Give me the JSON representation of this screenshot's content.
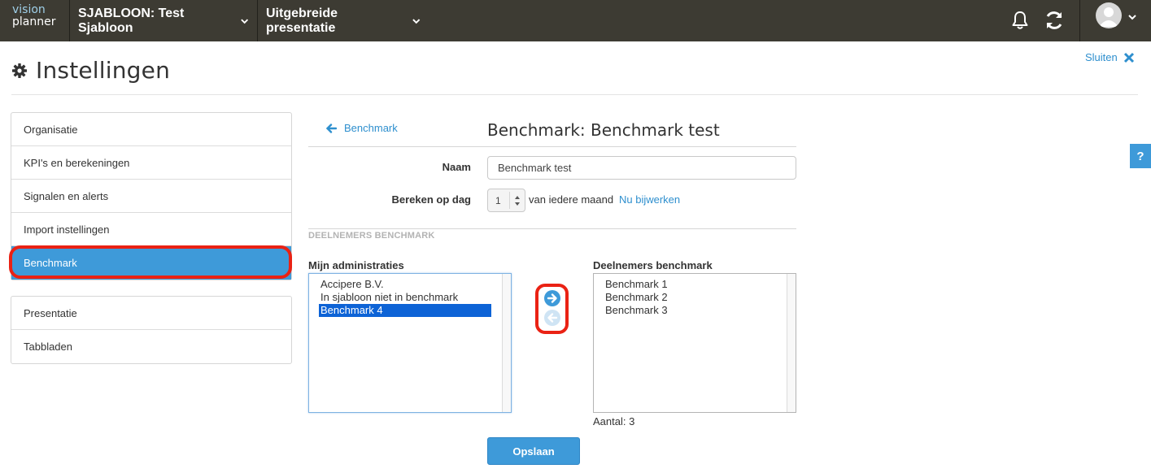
{
  "topbar": {
    "logo_line1": "vision",
    "logo_line2": "planner",
    "template_menu": "SJABLOON: Test Sjabloon",
    "presentation_menu": "Uitgebreide presentatie"
  },
  "page": {
    "title": "Instellingen",
    "close_label": "Sluiten"
  },
  "sidebar": {
    "group1": [
      {
        "label": "Organisatie"
      },
      {
        "label": "KPI's en berekeningen"
      },
      {
        "label": "Signalen en alerts"
      },
      {
        "label": "Import instellingen"
      },
      {
        "label": "Benchmark"
      }
    ],
    "group2": [
      {
        "label": "Presentatie"
      },
      {
        "label": "Tabbladen"
      }
    ]
  },
  "form": {
    "back_label": "Benchmark",
    "title": "Benchmark: Benchmark test",
    "name_label": "Naam",
    "name_value": "Benchmark test",
    "day_label": "Bereken op dag",
    "day_value": "1",
    "month_text": "van iedere maand",
    "refresh_label": "Nu bijwerken",
    "section_title": "DEELNEMERS BENCHMARK",
    "left_list_label": "Mijn administraties",
    "left_list": [
      "Accipere B.V.",
      "In sjabloon niet in benchmark",
      "Benchmark 4"
    ],
    "right_list_label": "Deelnemers benchmark",
    "right_list": [
      "Benchmark 1",
      "Benchmark 2",
      "Benchmark 3"
    ],
    "count_text": "Aantal: 3",
    "save_label": "Opslaan"
  },
  "help_label": "?",
  "colors": {
    "topbar": "#3d3b33",
    "accent": "#3e9ad9",
    "link": "#2e8fce",
    "highlight_annotation": "#ea2214",
    "selection": "#0d63d6"
  }
}
